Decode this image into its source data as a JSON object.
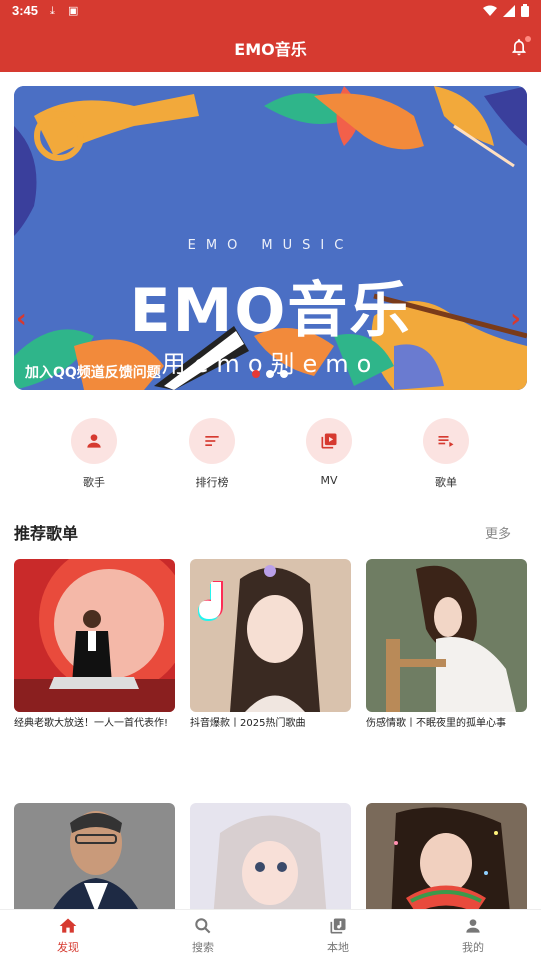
{
  "status": {
    "time": "3:45"
  },
  "app": {
    "title": "EMO音乐"
  },
  "banner": {
    "subtitle": "EMO   MUSIC",
    "headline": "EMO音乐",
    "slogan": "用emo别emo",
    "caption": "加入QQ频道反馈问题",
    "active_dot": 0
  },
  "categories": [
    {
      "label": "歌手",
      "icon": "person-icon"
    },
    {
      "label": "排行榜",
      "icon": "ranking-icon"
    },
    {
      "label": "MV",
      "icon": "video-library-icon"
    },
    {
      "label": "歌单",
      "icon": "playlist-icon"
    }
  ],
  "recommend": {
    "title": "推荐歌单",
    "more": "更多",
    "playlists": [
      {
        "title": "经典老歌大放送！一人一首代表作!"
      },
      {
        "title": "抖音爆款丨2025热门歌曲"
      },
      {
        "title": "伤感情歌丨不眠夜里的孤单心事"
      },
      {
        "title": ""
      },
      {
        "title": ""
      },
      {
        "title": ""
      }
    ]
  },
  "nav": [
    {
      "label": "发现",
      "icon": "home-icon",
      "active": true
    },
    {
      "label": "搜索",
      "icon": "search-icon",
      "active": false
    },
    {
      "label": "本地",
      "icon": "music-library-icon",
      "active": false
    },
    {
      "label": "我的",
      "icon": "user-icon",
      "active": false
    }
  ],
  "colors": {
    "primary": "#d63a30",
    "banner_bg": "#4b6fc4",
    "category_bg": "#fbe3e1"
  }
}
